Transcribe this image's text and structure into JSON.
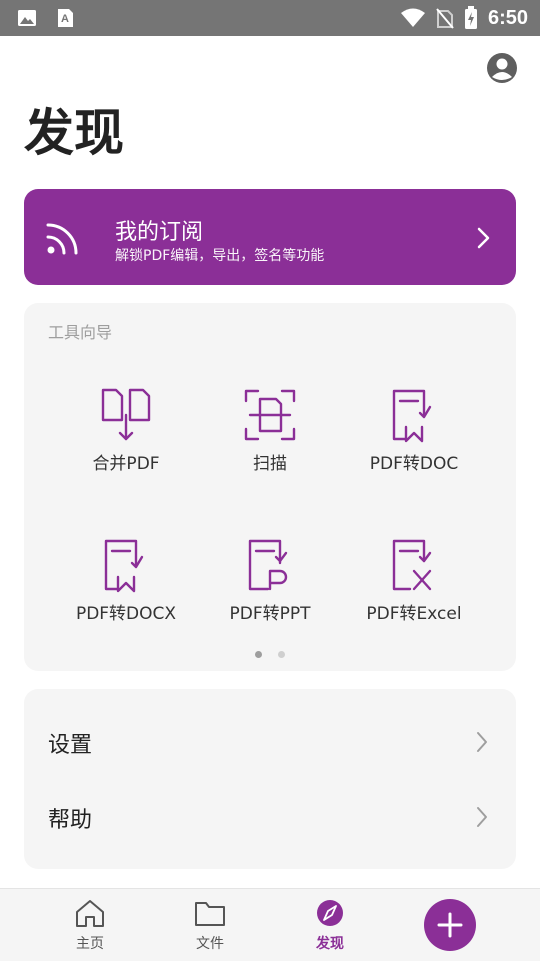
{
  "status_bar": {
    "time": "6:50"
  },
  "page": {
    "title": "发现"
  },
  "subscription": {
    "title": "我的订阅",
    "description": "解锁PDF编辑，导出，签名等功能"
  },
  "tools": {
    "title": "工具向导",
    "items": [
      {
        "label": "合并PDF",
        "icon": "merge-pdf-icon"
      },
      {
        "label": "扫描",
        "icon": "scan-icon"
      },
      {
        "label": "PDF转DOC",
        "icon": "doc-icon"
      },
      {
        "label": "PDF转DOCX",
        "icon": "docx-icon"
      },
      {
        "label": "PDF转PPT",
        "icon": "ppt-icon"
      },
      {
        "label": "PDF转Excel",
        "icon": "excel-icon"
      }
    ],
    "page_count": 2,
    "current_page": 1
  },
  "settings": {
    "items": [
      {
        "label": "设置"
      },
      {
        "label": "帮助"
      }
    ]
  },
  "bottom_nav": {
    "items": [
      {
        "label": "主页",
        "icon": "home-icon"
      },
      {
        "label": "文件",
        "icon": "folder-icon"
      },
      {
        "label": "发现",
        "icon": "compass-icon",
        "active": true
      }
    ],
    "fab_icon": "plus-icon"
  },
  "colors": {
    "accent": "#8b2f97",
    "status_bar": "#757575",
    "card_bg": "#f5f5f5"
  }
}
